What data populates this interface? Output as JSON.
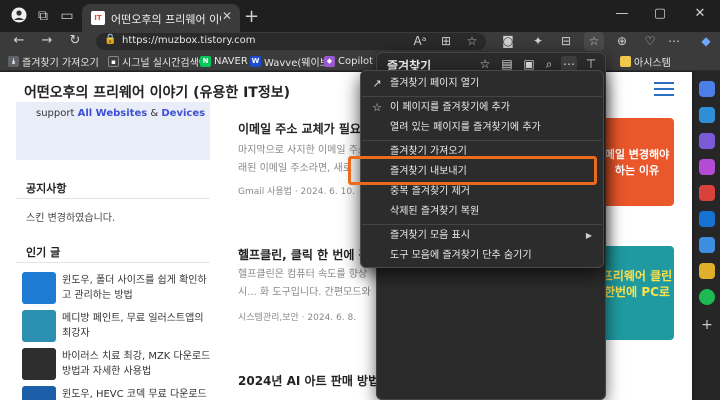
{
  "browser": {
    "tab_title": "어떤오후의 프리웨어 이야기 (유...",
    "url": "https://muzbox.tistory.com"
  },
  "bookmarks": [
    {
      "label": "즐겨찾기 가져오기",
      "icon": "import-icon",
      "color": "#5f6368"
    },
    {
      "label": "시그널 실시간검색어",
      "icon": "signal-icon",
      "color": "#3d3d3d"
    },
    {
      "label": "NAVER",
      "icon": "naver-icon",
      "color": "#03c75a"
    },
    {
      "label": "Wavve(웨이브)",
      "icon": "wavve-icon",
      "color": "#1e4bd2"
    },
    {
      "label": "Copilot",
      "icon": "copilot-icon",
      "color": "#9b59d0"
    },
    {
      "label": "아시스템",
      "icon": "folder-icon",
      "color": "#f2c94c"
    }
  ],
  "favorites_panel": {
    "title": "즐겨찾기"
  },
  "context_menu": {
    "items": [
      {
        "label": "즐겨찾기 페이지 열기",
        "icon": "open-page-icon"
      },
      {
        "label": "이 페이지를 즐겨찾기에 추가",
        "icon": "add-favorite-icon"
      },
      {
        "label": "열려 있는 페이지를 즐겨찾기에 추가",
        "icon": ""
      },
      {
        "label": "즐겨찾기 가져오기",
        "icon": ""
      },
      {
        "label": "즐겨찾기 내보내기",
        "icon": ""
      },
      {
        "label": "중복 즐겨찾기 제거",
        "icon": ""
      },
      {
        "label": "삭제된 즐겨찾기 복원",
        "icon": ""
      },
      {
        "label": "즐겨찾기 모음 표시",
        "icon": "",
        "submenu": true
      },
      {
        "label": "도구 모음에 즐겨찾기 단추 숨기기",
        "icon": ""
      }
    ],
    "highlighted_index": 4,
    "highlight_color": "#e86b1e"
  },
  "page": {
    "site_title": "어떤오후의 프리웨어 이야기 (유용한 IT정보)",
    "support_banner": {
      "prefix": "support",
      "emph1": "All Websites",
      "amp": "&",
      "emph2": "Devices"
    },
    "notice_heading": "공지사항",
    "notice_text": "스킨 변경하였습니다.",
    "popular_heading": "인기 글",
    "popular_posts": [
      {
        "title": "윈도우, 폴더 사이즈를 쉽게 확인하고 관리하는 방법",
        "thumb_color": "#1f7ad4"
      },
      {
        "title": "메디방 페인트, 무료 일러스트앱의 최강자",
        "thumb_color": "#2a8fb0"
      },
      {
        "title": "바이러스 치료 최강, MZK 다운로드 방법과 자세한 사용법",
        "thumb_color": "#2e2e2e"
      },
      {
        "title": "윈도우, HEVC 코덱 무료 다운로드",
        "thumb_color": "#1c5ea8"
      }
    ],
    "posts": [
      {
        "title": "이메일 주소 교체가 필요한",
        "desc": "마지막으로 사지한 이메일 주소... 래된 이메일 주소라면, 새로",
        "meta": "Gmail 사용법 · 2024. 6. 10.",
        "thumb_text": "메일 변경해야 하는 이유",
        "thumb_color": "#e9572a"
      },
      {
        "title": "헬프클린, 클릭 한 번에 광고",
        "desc": "헬프클린은 컴퓨터 속도를 향상시... 화 도구입니다. 간편모드와 전체모",
        "meta": "시스템관리,보안 · 2024. 6. 8.",
        "thumb_text": "프리웨어 클린 한번에 PC로",
        "thumb_color": "#1f9aa0"
      },
      {
        "title": "2024년 AI 아트 판매 방법 10",
        "desc": "",
        "meta": "",
        "thumb_text": "",
        "thumb_color": "#ffffff"
      }
    ]
  }
}
